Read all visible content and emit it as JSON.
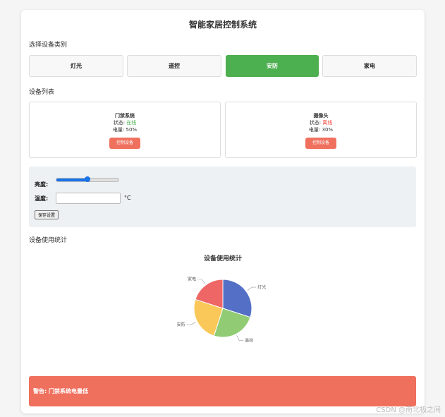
{
  "app": {
    "title": "智能家居控制系统"
  },
  "categories": {
    "heading": "选择设备类别",
    "items": [
      {
        "label": "灯光"
      },
      {
        "label": "遥控"
      },
      {
        "label": "安防",
        "active": true
      },
      {
        "label": "家电"
      }
    ]
  },
  "devices": {
    "heading": "设备列表",
    "items": [
      {
        "name": "门禁系统",
        "status_label": "状态: ",
        "status": "在线",
        "status_color": "#4caf50",
        "battery": "电量: 50%",
        "button": "控制设备"
      },
      {
        "name": "摄像头",
        "status_label": "状态: ",
        "status": "离线",
        "status_color": "#f44336",
        "battery": "电量: 30%",
        "button": "控制设备"
      }
    ]
  },
  "settings": {
    "brightness_label": "亮度:",
    "brightness_value": 50,
    "temperature_label": "温度:",
    "temperature_value": "",
    "temperature_unit": "°C",
    "save_button": "保存设置"
  },
  "stats": {
    "heading": "设备使用统计"
  },
  "chart_data": {
    "type": "pie",
    "title": "设备使用统计",
    "categories": [
      "灯光",
      "遥控",
      "安防",
      "家电"
    ],
    "values": [
      30,
      25,
      25,
      20
    ],
    "colors": [
      "#5470c6",
      "#91cc75",
      "#fac858",
      "#ee6666"
    ]
  },
  "alert": {
    "text": "警告: 门禁系统电量低"
  },
  "watermark": "CSDN @南北极之间"
}
